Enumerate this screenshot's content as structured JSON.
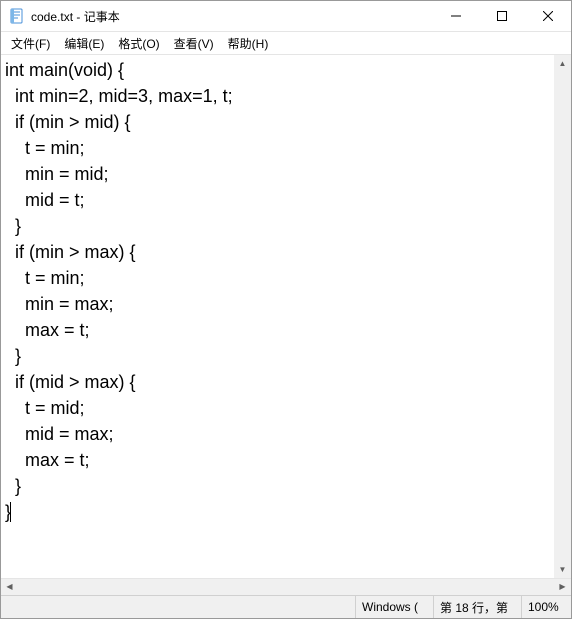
{
  "titlebar": {
    "title": "code.txt - 记事本"
  },
  "menu": {
    "file": "文件(F)",
    "edit": "编辑(E)",
    "format": "格式(O)",
    "view": "查看(V)",
    "help": "帮助(H)"
  },
  "editor": {
    "content": "int main(void) {\n  int min=2, mid=3, max=1, t;\n  if (min > mid) {\n    t = min;\n    min = mid;\n    mid = t;\n  }\n  if (min > max) {\n    t = min;\n    min = max;\n    max = t;\n  }\n  if (mid > max) {\n    t = mid;\n    mid = max;\n    max = t;\n  }\n}"
  },
  "statusbar": {
    "encoding": "Windows (",
    "position": "第 18 行，第",
    "zoom": "100%"
  }
}
